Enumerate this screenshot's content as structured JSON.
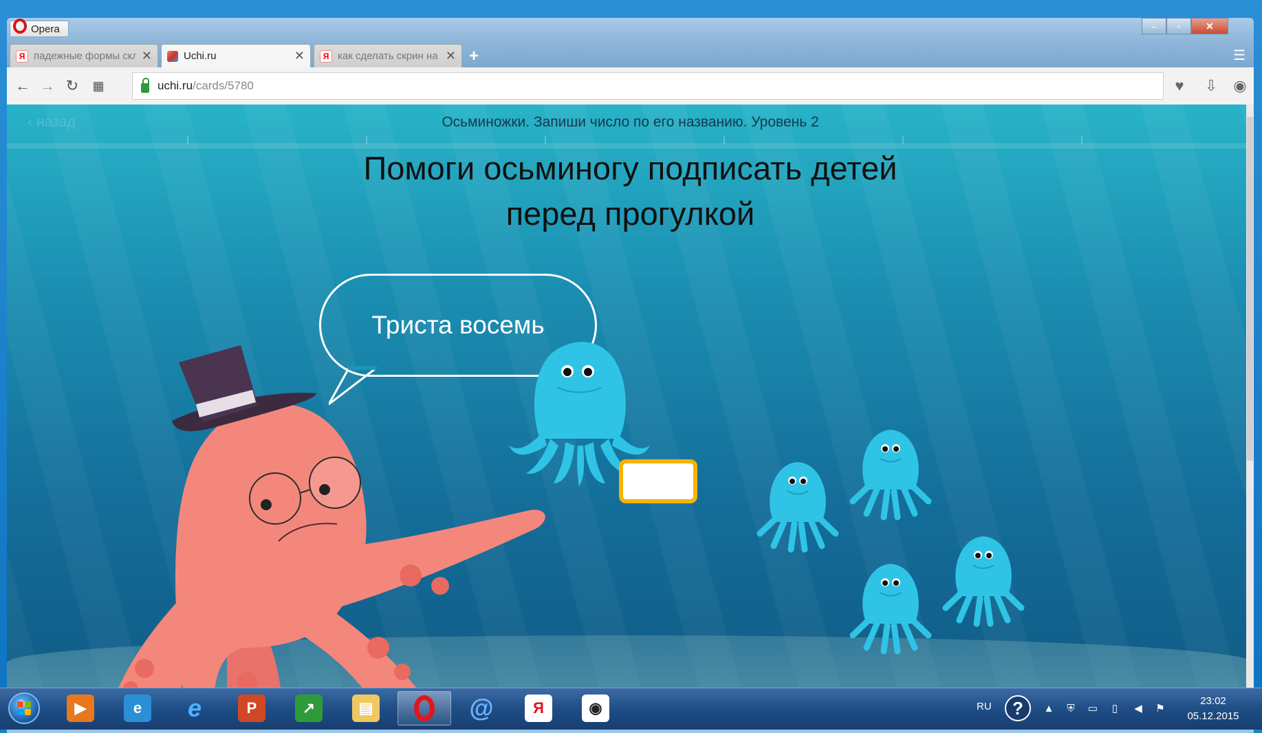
{
  "browser": {
    "app_name": "Opera",
    "tabs": [
      {
        "label": "падежные формы склон...",
        "favicon": "yandex-icon",
        "active": false
      },
      {
        "label": "Uchi.ru",
        "favicon": "uchi-icon",
        "active": true
      },
      {
        "label": "как сделать скрин на ком...",
        "favicon": "yandex-icon",
        "active": false
      }
    ],
    "new_tab": "+",
    "url_host": "uchi.ru",
    "url_path": "/cards/5780"
  },
  "page": {
    "back_label": "назад",
    "title": "Осьминожки. Запиши число по его названию. Уровень 2",
    "heading_line1": "Помоги осьминогу подписать детей",
    "heading_line2": "перед прогулкой",
    "speech": "Триста восемь",
    "answer_value": ""
  },
  "taskbar": {
    "apps": [
      "media-player-icon",
      "internet-explorer-icon",
      "internet-explorer-blue-icon",
      "powerpoint-icon",
      "chart-app-icon",
      "file-explorer-icon",
      "opera-icon",
      "mail-icon",
      "yandex-browser-icon",
      "camera-app-icon"
    ],
    "language": "RU",
    "time": "23:02",
    "date": "05.12.2015"
  },
  "colors": {
    "sea_top": "#28b3c8",
    "sea_bottom": "#0f5a84",
    "octopus": "#f4877c",
    "jelly": "#2fc4e6",
    "answer_border": "#f4b400"
  }
}
